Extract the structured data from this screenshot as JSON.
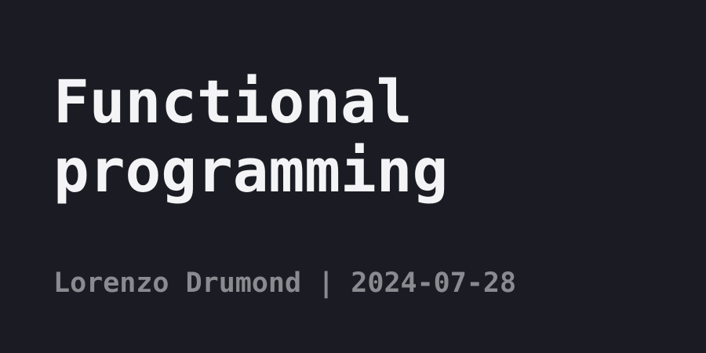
{
  "post": {
    "title": "Functional\nprogramming",
    "author": "Lorenzo Drumond",
    "separator": " | ",
    "date": "2024-07-28"
  },
  "colors": {
    "background": "#1b1c23",
    "title": "#f4f4f6",
    "meta": "#8a8b90"
  }
}
